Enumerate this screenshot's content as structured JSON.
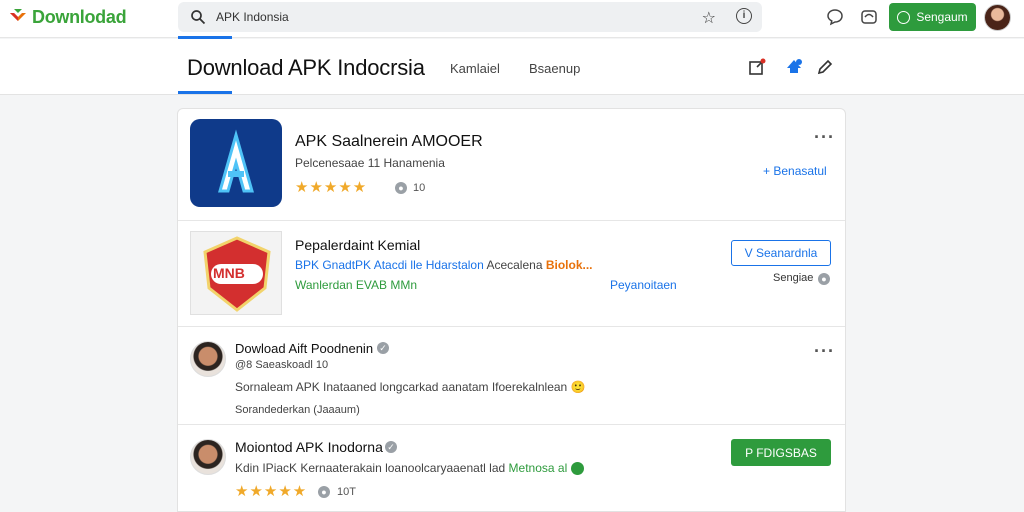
{
  "topbar": {
    "logo_text": "Downlodad",
    "search_value": "APK Indonsia",
    "signin_label": "Sengaum"
  },
  "header": {
    "title": "Download APK Indocrsia",
    "nav": [
      "Kamlaiel",
      "Bsaenup"
    ]
  },
  "apps": {
    "app1": {
      "title": "APK Saalnerein AMOOER",
      "subtitle": "Pelcenesaae 11 Hanamenia",
      "rating": 5,
      "count": "10",
      "action": "+ Benasatul"
    },
    "app2": {
      "title": "Pepalerdaint Kemial",
      "logo_text": "MNB",
      "line1_prefix": "BPK GnadtPK Atacdi lle Hdarstalon",
      "line1_mid": "Acecalena",
      "line1_orange": "Biolok...",
      "line2_green": "Wanlerdan EVAB MMn",
      "line2_blue": "Peyanoitaen",
      "button": "V Seanardnla",
      "side_text": "Sengiae"
    }
  },
  "reviews": [
    {
      "name": "Dowload Aift Poodnenin",
      "meta": "@8 Saeaskoadl 10",
      "text": "Sornaleam APK Inataaned longcarkad aanatam Ifoerekalnlean",
      "emoji": "🙂",
      "footer": "Sorandederkan (Jaaaum)"
    },
    {
      "name": "Moiontod APK Inodorna",
      "text_prefix": "Kdin IPiacK Kernaaterakain loanoolcaryaaenatl lad",
      "text_green": "Metnosa al",
      "rating": 5,
      "count": "10T",
      "button": "P FDIGSBAS"
    }
  ],
  "colors": {
    "brand_green": "#2e9b3d",
    "accent_blue": "#1a73e8",
    "star": "#f0a92a",
    "orange": "#e8710a"
  }
}
